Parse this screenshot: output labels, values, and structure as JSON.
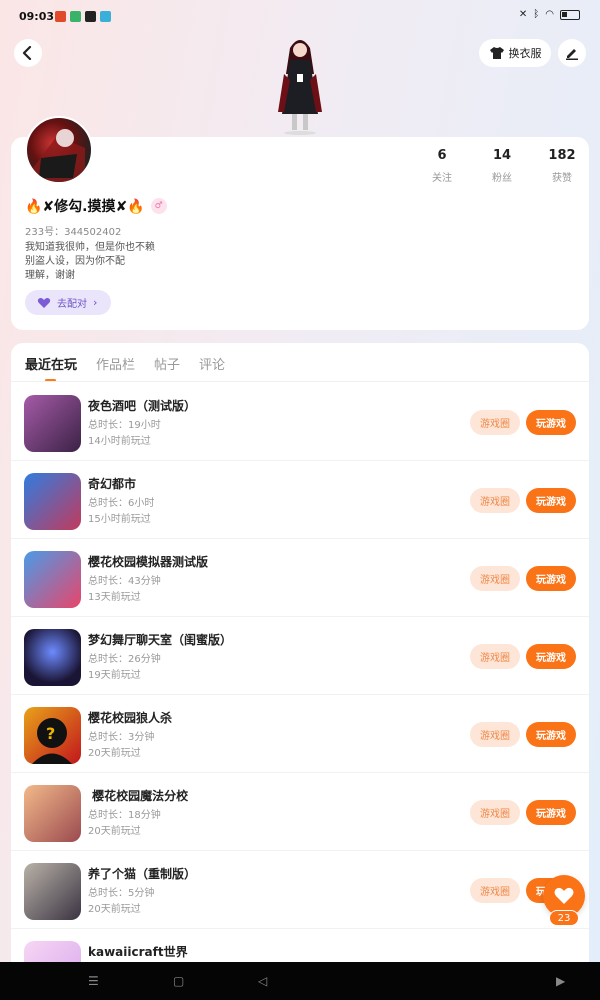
{
  "status_bar": {
    "time": "09:03"
  },
  "header": {
    "outfit_label": "换衣服",
    "icons": [
      "back-arrow-icon",
      "tshirt-icon",
      "edit-icon"
    ]
  },
  "profile": {
    "stats": [
      {
        "value": "6",
        "label": "关注"
      },
      {
        "value": "14",
        "label": "粉丝"
      },
      {
        "value": "182",
        "label": "获赞"
      }
    ],
    "nickname": "🔥✘修勾.摸摸✘🔥",
    "gender_symbol": "♂",
    "uid": "233号：344502402",
    "bio_lines": [
      "我知道我很帅，但是你也不赖",
      "别盗人设，因为你不配",
      "理解，谢谢"
    ],
    "pair_label": "去配对"
  },
  "tabs": [
    {
      "label": "最近在玩",
      "active": true
    },
    {
      "label": "作品栏",
      "active": false
    },
    {
      "label": "帖子",
      "active": false
    },
    {
      "label": "评论",
      "active": false
    }
  ],
  "games": [
    {
      "name": "夜色酒吧（测试版）",
      "duration": "总时长：19小时",
      "last_played": "14小时前玩过",
      "circle_label": "游戏圈",
      "play_label": "玩游戏"
    },
    {
      "name": "奇幻都市",
      "duration": "总时长：6小时",
      "last_played": "15小时前玩过",
      "circle_label": "游戏圈",
      "play_label": "玩游戏"
    },
    {
      "name": "樱花校园模拟器测试版",
      "duration": "总时长：43分钟",
      "last_played": "13天前玩过",
      "circle_label": "游戏圈",
      "play_label": "玩游戏"
    },
    {
      "name": "梦幻舞厅聊天室（闺蜜版）",
      "duration": "总时长：26分钟",
      "last_played": "19天前玩过",
      "circle_label": "游戏圈",
      "play_label": "玩游戏"
    },
    {
      "name": "樱花校园狼人杀",
      "duration": "总时长：3分钟",
      "last_played": "20天前玩过",
      "circle_label": "游戏圈",
      "play_label": "玩游戏"
    },
    {
      "name": " 樱花校园魔法分校",
      "duration": "总时长：18分钟",
      "last_played": "20天前玩过",
      "circle_label": "游戏圈",
      "play_label": "玩游戏"
    },
    {
      "name": "养了个猫（重制版）",
      "duration": "总时长：5分钟",
      "last_played": "20天前玩过",
      "circle_label": "游戏圈",
      "play_label": "玩游戏"
    },
    {
      "name": "kawaiicraft世界",
      "duration": "",
      "last_played": "",
      "circle_label": "",
      "play_label": ""
    }
  ],
  "like_fab": {
    "count": "23"
  },
  "colors": {
    "accent": "#fa7317",
    "accent_light": "#fde6d8",
    "pair_bg": "#ebe5fb"
  }
}
